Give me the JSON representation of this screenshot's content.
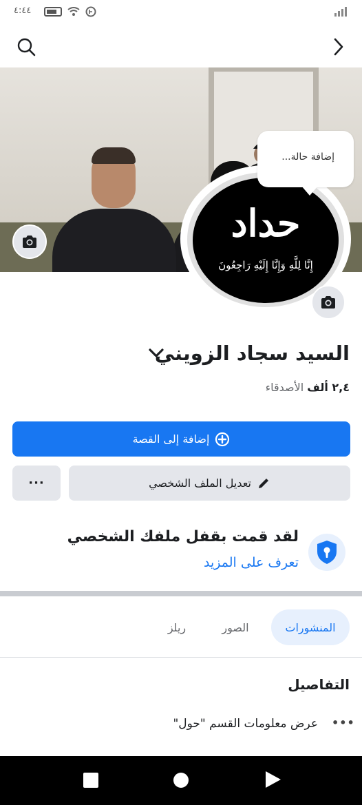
{
  "status_bar": {
    "time": "٤:٤٤"
  },
  "profile": {
    "name": "السيد سجاد الزويني",
    "friends_count": "٢,٤ ألف",
    "friends_label": "الأصدقاء",
    "avatar_title": "حداد",
    "avatar_verse": "إِنَّا لِلَّهِ وَإِنَّا إِلَيْهِ رَاجِعُونَ"
  },
  "status_bubble": {
    "text": "إضافة حالة..."
  },
  "actions": {
    "add_story": "إضافة إلى القصة",
    "edit_profile": "تعديل الملف الشخصي",
    "more": "···"
  },
  "lock_notice": {
    "title": "لقد قمت بقفل ملفك الشخصي",
    "link": "تعرف على المزيد"
  },
  "tabs": [
    {
      "label": "المنشورات",
      "active": true
    },
    {
      "label": "الصور",
      "active": false
    },
    {
      "label": "ريلز",
      "active": false
    }
  ],
  "details": {
    "title": "التفاصيل",
    "about_row": "عرض معلومات القسم \"حول\"",
    "dots": "•••"
  },
  "icons": {
    "search": "search-icon",
    "forward": "chevron-right-icon",
    "camera": "camera-icon",
    "chevron_down": "chevron-down-icon",
    "plus": "plus-circle-icon",
    "pencil": "pencil-icon",
    "shield": "shield-lock-icon"
  },
  "colors": {
    "accent": "#1877f2",
    "secondary_button": "#e4e6eb",
    "active_tab_bg": "#e7f0fd"
  }
}
